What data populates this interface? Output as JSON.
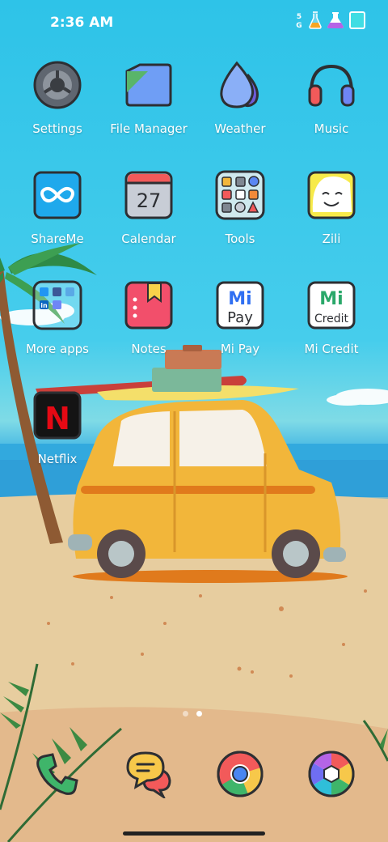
{
  "status_bar": {
    "time": "2:36 AM",
    "icons": [
      "5g-icon",
      "flask-orange-icon",
      "flask-purple-icon",
      "battery-icon"
    ],
    "network": "5G"
  },
  "apps": [
    {
      "label": "Settings",
      "icon": "settings-gear-icon"
    },
    {
      "label": "File Manager",
      "icon": "folder-icon"
    },
    {
      "label": "Weather",
      "icon": "water-drop-icon"
    },
    {
      "label": "Music",
      "icon": "headphones-icon"
    },
    {
      "label": "ShareMe",
      "icon": "infinity-icon"
    },
    {
      "label": "Calendar",
      "icon": "calendar-icon",
      "day": "27"
    },
    {
      "label": "Tools",
      "icon": "tools-folder-icon"
    },
    {
      "label": "Zili",
      "icon": "smiley-face-icon"
    },
    {
      "label": "More apps",
      "icon": "more-apps-folder-icon",
      "badge": "in"
    },
    {
      "label": "Notes",
      "icon": "notes-bookmark-icon"
    },
    {
      "label": "Mi Pay",
      "icon": "mi-pay-icon",
      "brand": "Mi",
      "sub": "Pay"
    },
    {
      "label": "Mi Credit",
      "icon": "mi-credit-icon",
      "brand": "Mi",
      "sub": "Credit"
    },
    {
      "label": "Netflix",
      "icon": "netflix-icon",
      "letter": "N"
    }
  ],
  "dock": [
    {
      "name": "phone",
      "icon": "phone-icon"
    },
    {
      "name": "messages",
      "icon": "chat-bubble-icon"
    },
    {
      "name": "chrome",
      "icon": "chrome-icon"
    },
    {
      "name": "gallery",
      "icon": "camera-aperture-icon"
    }
  ],
  "page_indicator": {
    "pages": 2,
    "current": 2
  },
  "colors": {
    "accent_red": "#f25a5a",
    "sky": "#3cc6ea",
    "sand": "#e8cb9c",
    "car_yellow": "#f2b63a"
  }
}
